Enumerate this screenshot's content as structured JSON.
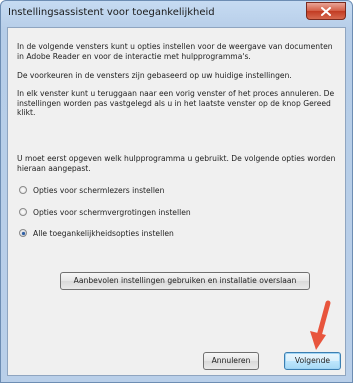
{
  "window": {
    "title": "Instellingsassistent voor toegankelijkheid"
  },
  "content": {
    "intro": "In de volgende vensters kunt u opties instellen voor de weergave van documenten in Adobe Reader en voor de interactie met hulpprogramma's.",
    "preferences": "De voorkeuren in de vensters zijn gebaseerd op uw huidige instellingen.",
    "navigation": "In elk venster kunt u teruggaan naar een vorig venster of het proces annuleren. De instellingen worden pas vastgelegd als u in het laatste venster op de knop Gereed klikt.",
    "instruction": "U moet eerst opgeven welk hulpprogramma u gebruikt. De volgende opties worden hieraan aangepast."
  },
  "options": [
    {
      "label": "Opties voor schermlezers instellen",
      "checked": false
    },
    {
      "label": "Opties voor schermvergrotingen instellen",
      "checked": false
    },
    {
      "label": "Alle toegankelijkheidsopties instellen",
      "checked": true
    }
  ],
  "buttons": {
    "skip": "Aanbevolen instellingen gebruiken en installatie overslaan",
    "cancel": "Annuleren",
    "next": "Volgende"
  },
  "colors": {
    "annotation_arrow": "#e8553d",
    "close_button": "#c94a33"
  }
}
